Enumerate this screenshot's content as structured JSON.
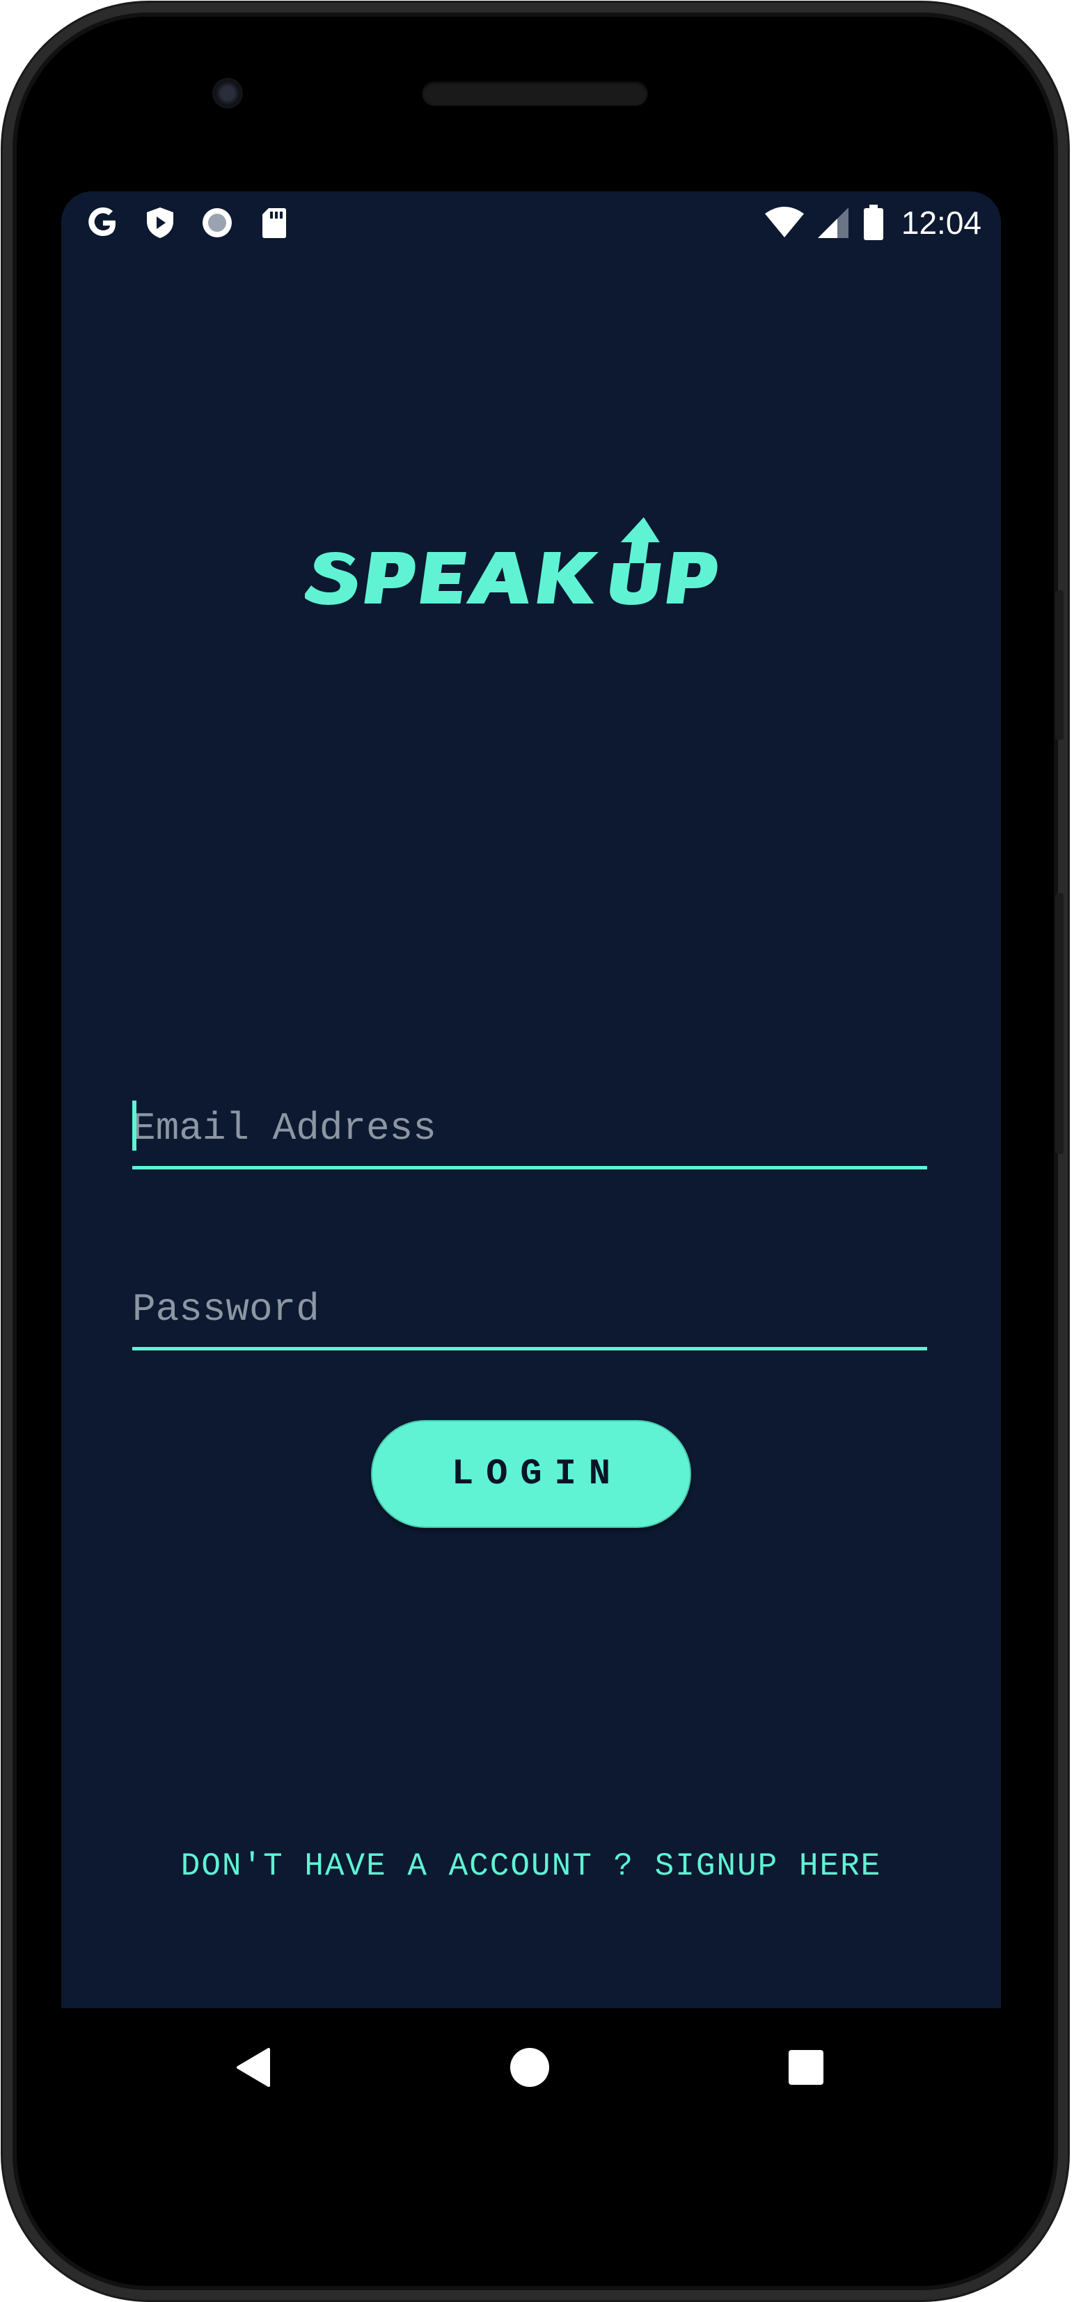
{
  "status_bar": {
    "left_icons": [
      "google-icon",
      "play-protect-icon",
      "record-icon",
      "sd-card-icon"
    ],
    "right_icons": [
      "wifi-icon",
      "cellular-signal-icon",
      "battery-icon"
    ],
    "time": "12:04"
  },
  "app": {
    "logo_text": "SPEAK UP",
    "accent_color": "#5ff3d4",
    "background_color": "#0c1930"
  },
  "form": {
    "email": {
      "placeholder": "Email Address",
      "value": ""
    },
    "password": {
      "placeholder": "Password",
      "value": ""
    },
    "login_label": "LOGIN"
  },
  "footer": {
    "signup_link": "DON'T HAVE A ACCOUNT ? SIGNUP HERE"
  },
  "nav_bar": {
    "buttons": [
      "back-icon",
      "home-icon",
      "recents-icon"
    ]
  }
}
